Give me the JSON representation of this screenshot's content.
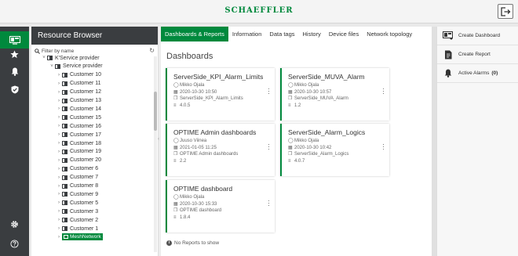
{
  "header": {
    "brand": "SCHAEFFLER",
    "logout_icon": "logout-icon"
  },
  "rail": {
    "items": [
      {
        "name": "dashboard-icon",
        "active": true
      },
      {
        "name": "star-icon"
      },
      {
        "name": "bell-icon"
      },
      {
        "name": "shield-icon"
      }
    ],
    "bottom": [
      {
        "name": "gear-icon"
      },
      {
        "name": "help-icon"
      }
    ]
  },
  "resource_browser": {
    "title": "Resource Browser",
    "filter_placeholder": "Filter by name",
    "tree": [
      {
        "label": "K'Service provider",
        "level": 0,
        "expanded": true
      },
      {
        "label": "Service provider",
        "level": 1,
        "expanded": true
      },
      {
        "label": "Customer 10",
        "level": 2
      },
      {
        "label": "Customer 11",
        "level": 2
      },
      {
        "label": "Customer 12",
        "level": 2
      },
      {
        "label": "Customer 13",
        "level": 2
      },
      {
        "label": "Customer 14",
        "level": 2
      },
      {
        "label": "Customer 15",
        "level": 2
      },
      {
        "label": "Customer 16",
        "level": 2
      },
      {
        "label": "Customer 17",
        "level": 2
      },
      {
        "label": "Customer 18",
        "level": 2
      },
      {
        "label": "Customer 19",
        "level": 2
      },
      {
        "label": "Customer 20",
        "level": 2
      },
      {
        "label": "Customer 6",
        "level": 2
      },
      {
        "label": "Customer 7",
        "level": 2
      },
      {
        "label": "Customer 8",
        "level": 2
      },
      {
        "label": "Customer 9",
        "level": 2
      },
      {
        "label": "Customer 5",
        "level": 2
      },
      {
        "label": "Customer 3",
        "level": 2
      },
      {
        "label": "Customer 2",
        "level": 2
      },
      {
        "label": "Customer 1",
        "level": 2
      },
      {
        "label": "MeshNetwork",
        "level": 2,
        "highlight": true
      }
    ]
  },
  "tabs": [
    {
      "label": "Dashboards & Reports",
      "active": true
    },
    {
      "label": "Information"
    },
    {
      "label": "Data tags"
    },
    {
      "label": "History"
    },
    {
      "label": "Device files"
    },
    {
      "label": "Network topology"
    }
  ],
  "main": {
    "title": "Dashboards",
    "no_reports": "No Reports to show",
    "cards": [
      {
        "title": "ServerSide_KPI_Alarm_Limits",
        "author": "Mikko Ojala",
        "date": "2020-10-30 10:50",
        "source": "ServerSide_KPI_Alarm_Limits",
        "version": "4.0.5"
      },
      {
        "title": "ServerSide_MUVA_Alarm",
        "author": "Mikko Ojala",
        "date": "2020-10-30 10:57",
        "source": "ServerSide_MUVA_Alarm",
        "version": "1.2"
      },
      {
        "title": "OPTIME Admin dashboards",
        "author": "Juuso Viinea",
        "date": "2021-01-05 11:25",
        "source": "OPTIME Admin dashboards",
        "version": "2.2"
      },
      {
        "title": "ServerSide_Alarm_Logics",
        "author": "Mikko Ojala",
        "date": "2020-10-30 10:42",
        "source": "ServerSide_Alarm_Logics",
        "version": "4.0.7"
      },
      {
        "title": "OPTIME dashboard",
        "author": "Mikko Ojala",
        "date": "2020-10-30 15:33",
        "source": "OPTIME dashboard",
        "version": "1.8.4"
      }
    ]
  },
  "right_panel": {
    "items": [
      {
        "label": "Create Dashboard",
        "icon": "create-dashboard-icon"
      },
      {
        "label": "Create Report",
        "icon": "create-report-icon"
      },
      {
        "label": "Active Alarms",
        "icon": "bell-icon",
        "count": "(0)"
      }
    ]
  }
}
